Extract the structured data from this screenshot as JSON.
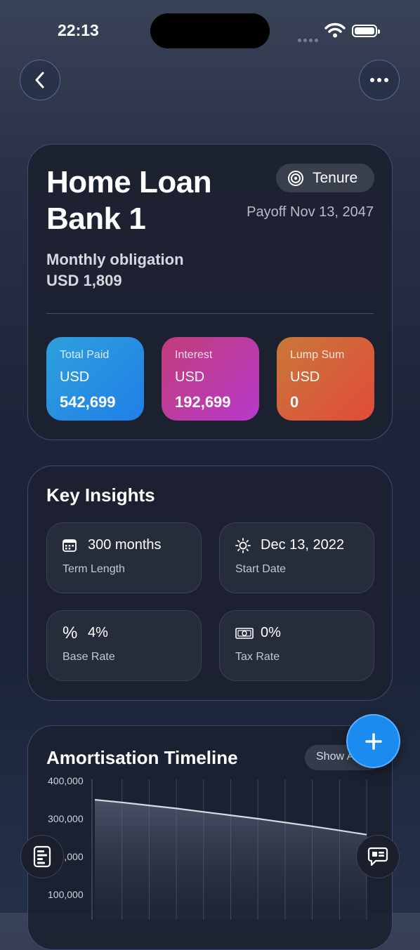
{
  "status": {
    "time": "22:13"
  },
  "loan": {
    "title_line1": "Home Loan",
    "title_line2": "Bank 1",
    "tenure_label": "Tenure",
    "payoff": "Payoff Nov 13, 2047",
    "obligation_label": "Monthly obligation",
    "obligation_value": "USD 1,809"
  },
  "stats": [
    {
      "label": "Total Paid",
      "currency": "USD",
      "value": "542,699"
    },
    {
      "label": "Interest",
      "currency": "USD",
      "value": "192,699"
    },
    {
      "label": "Lump Sum",
      "currency": "USD",
      "value": "0"
    }
  ],
  "insights": {
    "title": "Key Insights",
    "tiles": [
      {
        "icon": "calendar-icon",
        "value": "300 months",
        "label": "Term Length"
      },
      {
        "icon": "sun-icon",
        "value": "Dec 13, 2022",
        "label": "Start Date"
      },
      {
        "icon": "percent-icon",
        "value": "4%",
        "label": "Base Rate"
      },
      {
        "icon": "banknote-icon",
        "value": "0%",
        "label": "Tax Rate"
      }
    ]
  },
  "timeline": {
    "title": "Amortisation Timeline",
    "show_label": "Show All",
    "y_ticks": [
      "400,000",
      "300,000",
      "200,000",
      "100,000"
    ]
  },
  "chart_data": {
    "type": "area",
    "title": "Amortisation Timeline",
    "ylim": [
      0,
      400000
    ],
    "y_ticks": [
      400000,
      300000,
      200000,
      100000
    ],
    "series": [
      {
        "values": [
          350000,
          343000,
          335000,
          327000,
          318000,
          309000,
          300000,
          290000,
          280000,
          269000,
          258000
        ]
      }
    ]
  }
}
